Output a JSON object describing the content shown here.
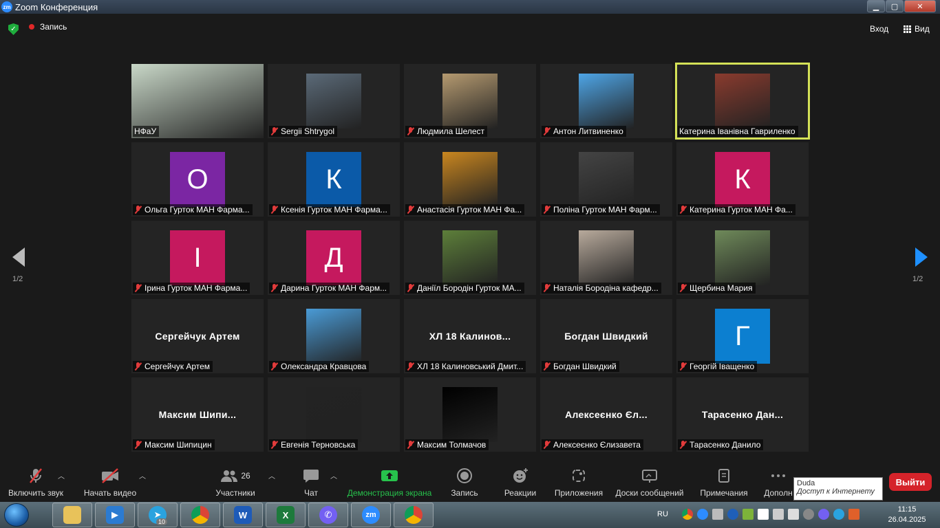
{
  "window": {
    "title": "Zoom Конференция",
    "logo_text": "zm"
  },
  "topbar": {
    "recording": "Запись",
    "enter": "Вход",
    "view": "Вид"
  },
  "pager": {
    "left": "1/2",
    "right": "1/2"
  },
  "tiles": [
    {
      "name": "НФаУ",
      "type": "photo",
      "color": "#c9d8c8",
      "muted": false
    },
    {
      "name": "Sergii Shtrygol",
      "type": "photo",
      "color": "#5b6a78",
      "muted": true
    },
    {
      "name": "Людмила Шелест",
      "type": "photo",
      "color": "#b59a70",
      "muted": true
    },
    {
      "name": "Антон Литвиненко",
      "type": "photo",
      "color": "#4ea5e6",
      "muted": true
    },
    {
      "name": "Катерина Іванівна Гавриленко",
      "type": "photo",
      "color": "#8a3b2e",
      "muted": false,
      "active": true
    },
    {
      "name": "Ольга Гурток МАН Фарма...",
      "type": "avatar",
      "letter": "О",
      "color": "#7b26a3",
      "muted": true
    },
    {
      "name": "Ксенія Гурток МАН Фарма...",
      "type": "avatar",
      "letter": "К",
      "color": "#0b5aa8",
      "muted": true
    },
    {
      "name": "Анастасія Гурток МАН Фа...",
      "type": "photo",
      "color": "#c9861f",
      "muted": true
    },
    {
      "name": "Поліна Гурток МАН Фарм...",
      "type": "photo",
      "color": "#444444",
      "muted": true
    },
    {
      "name": "Катерина Гурток МАН Фа...",
      "type": "avatar",
      "letter": "К",
      "color": "#c5195e",
      "muted": true
    },
    {
      "name": "Ірина Гурток МАН Фарма...",
      "type": "avatar",
      "letter": "І",
      "color": "#c5195e",
      "muted": true
    },
    {
      "name": "Дарина Гурток МАН Фарм...",
      "type": "avatar",
      "letter": "Д",
      "color": "#c5195e",
      "muted": true
    },
    {
      "name": "Даніїл Бородін Гурток МА...",
      "type": "photo",
      "color": "#5d7f3a",
      "muted": true
    },
    {
      "name": "Наталія Бородіна кафедр...",
      "type": "photo",
      "color": "#b8aa9c",
      "muted": true
    },
    {
      "name": "Щербина Мария",
      "type": "photo",
      "color": "#6f8a5a",
      "muted": true
    },
    {
      "name": "Сергейчук Артем",
      "type": "name",
      "big": "Сергейчук Артем",
      "muted": true
    },
    {
      "name": "Олександра Кравцова",
      "type": "photo",
      "color": "#4a9bd6",
      "muted": true
    },
    {
      "name": "ХЛ 18 Калиновський Дмит...",
      "type": "name",
      "big": "ХЛ 18 Калинов...",
      "muted": true
    },
    {
      "name": "Богдан Швидкий",
      "type": "name",
      "big": "Богдан Швидкий",
      "muted": true
    },
    {
      "name": "Георгій Іващенко",
      "type": "avatar",
      "letter": "Г",
      "color": "#0c7fd0",
      "muted": true
    },
    {
      "name": "Максим Шипицин",
      "type": "name",
      "big": "Максим Шипи...",
      "muted": true
    },
    {
      "name": "Евгенія Терновська",
      "type": "photo",
      "color": "#232323",
      "muted": true
    },
    {
      "name": "Максим Толмачов",
      "type": "photo",
      "color": "#000000",
      "muted": true
    },
    {
      "name": "Алексеєнко Єлизавета",
      "type": "name",
      "big": "Алексеєнко Єл...",
      "muted": true
    },
    {
      "name": "Тарасенко Данило",
      "type": "name",
      "big": "Тарасенко Дан...",
      "muted": true
    }
  ],
  "toolbar": {
    "unmute": "Включить звук",
    "video": "Начать видео",
    "participants": "Участники",
    "participants_count": "26",
    "chat": "Чат",
    "share": "Демонстрация экрана",
    "record": "Запись",
    "reactions": "Реакции",
    "apps": "Приложения",
    "whiteboards": "Доски сообщений",
    "notes": "Примечания",
    "more": "Дополн",
    "leave": "Выйти"
  },
  "tooltip": {
    "title": "Duda",
    "text": "Доступ к Интернету"
  },
  "taskbar": {
    "lang": "RU",
    "time": "11:15",
    "date": "26.04.2025",
    "telegram_badge": "10"
  }
}
